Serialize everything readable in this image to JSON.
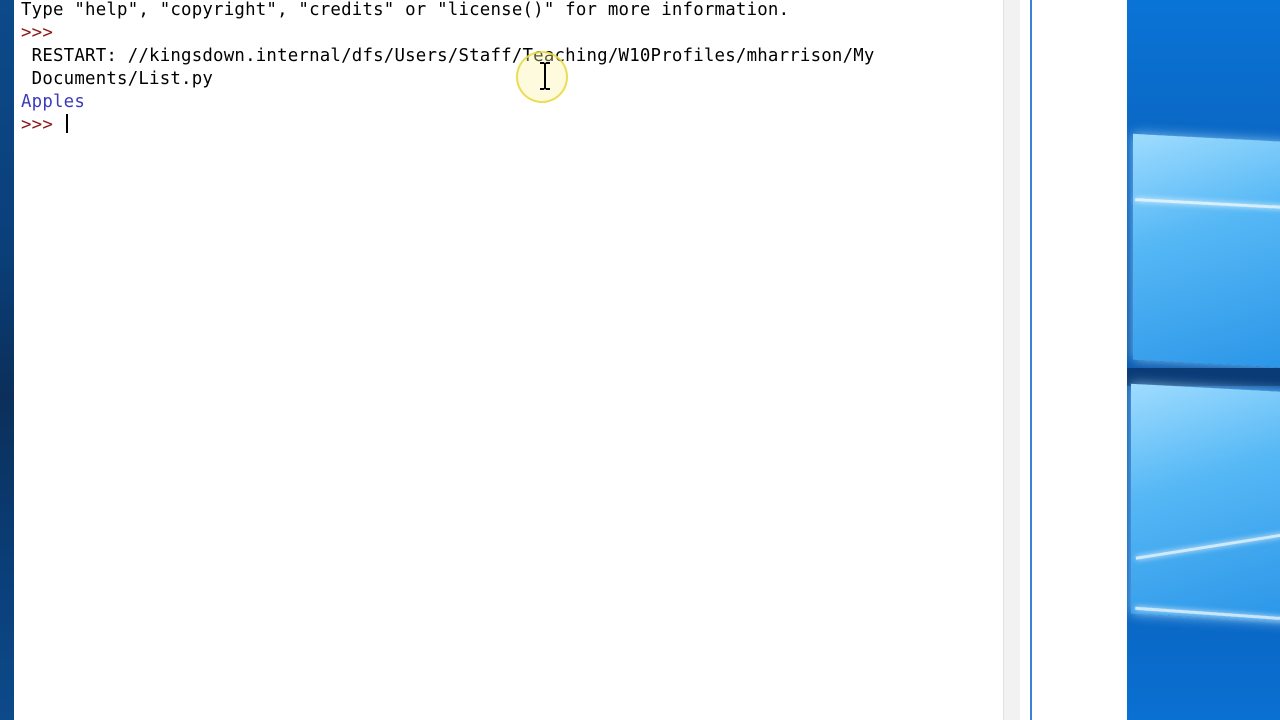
{
  "shell": {
    "lines": {
      "banner": "Type \"help\", \"copyright\", \"credits\" or \"license()\" for more information.",
      "prompt1": ">>> ",
      "restart_1": " RESTART: //kingsdown.internal/dfs/Users/Staff/Teaching/W10Profiles/mharrison/My",
      "restart_2": " Documents/List.py",
      "output": "Apples",
      "prompt2": ">>> "
    }
  },
  "colors": {
    "prompt": "#8b1a1a",
    "output": "#3b3bbb",
    "desktop_blue": "#0a5bb0"
  },
  "icons": {
    "cursor": "i-beam-cursor-icon",
    "logo": "windows-logo-icon"
  }
}
